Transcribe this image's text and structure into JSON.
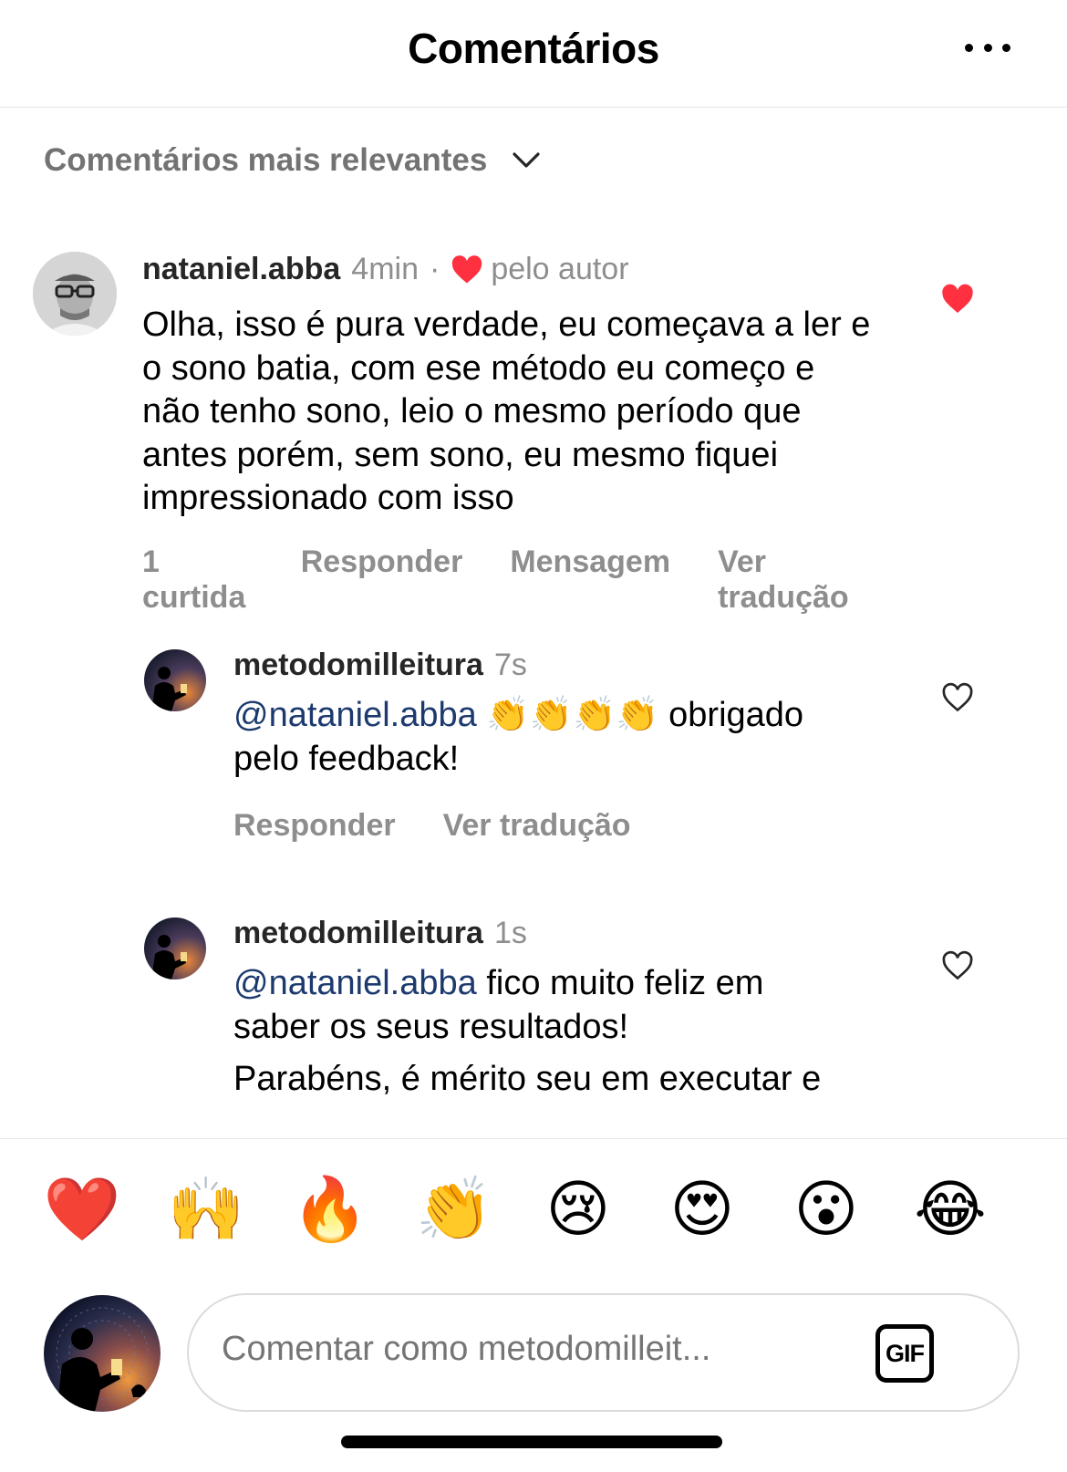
{
  "header": {
    "title": "Comentários",
    "more_icon": "more-horizontal-icon"
  },
  "sort": {
    "label": "Comentários mais relevantes",
    "icon": "chevron-down-icon"
  },
  "comments": [
    {
      "username": "nataniel.abba",
      "time": "4min",
      "separator": "·",
      "liked_by_author": "pelo autor",
      "text": "Olha, isso é pura verdade, eu começava  a ler e o sono batia, com ese método eu começo e não tenho sono, leio o mesmo período que antes porém, sem sono, eu mesmo fiquei impressionado com isso",
      "likes": "1 curtida",
      "reply": "Responder",
      "message": "Mensagem",
      "translate": "Ver tradução",
      "liked": true
    },
    {
      "username": "metodomilleitura",
      "time": "7s",
      "mention": "@nataniel.abba",
      "text_a": " 👏👏👏👏 obrigado",
      "text_b": "pelo feedback!",
      "reply": "Responder",
      "translate": "Ver tradução",
      "liked": false
    },
    {
      "username": "metodomilleitura",
      "time": "1s",
      "mention": "@nataniel.abba",
      "text_a": " fico muito feliz em",
      "text_b": "saber os seus resultados!",
      "text_c": "Parabéns, é mérito seu em executar e",
      "liked": false
    }
  ],
  "reactions": [
    "❤️",
    "🙌",
    "🔥",
    "👏",
    "😢",
    "😍",
    "😮",
    "😂"
  ],
  "composer": {
    "placeholder": "Comentar como metodomilleit...",
    "gif_label": "GIF"
  },
  "colors": {
    "like_red": "#ff3040",
    "mention_blue": "#1d3a6e",
    "secondary_text": "#8e8e8e"
  }
}
